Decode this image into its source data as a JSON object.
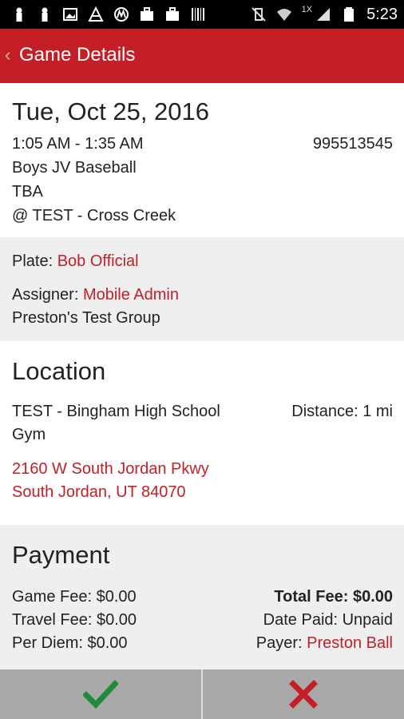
{
  "status_bar": {
    "time": "5:23",
    "network_label": "1X",
    "icons": [
      "notification-icon",
      "notification-icon",
      "image-icon",
      "app-icon",
      "motorola-icon",
      "briefcase-icon",
      "briefcase-icon",
      "barcode-icon",
      "no-vibrate-icon",
      "wifi-icon",
      "signal-icon",
      "battery-icon"
    ]
  },
  "toolbar": {
    "title": "Game Details"
  },
  "game": {
    "date": "Tue, Oct 25, 2016",
    "time_range": "1:05 AM - 1:35 AM",
    "game_id": "995513545",
    "level": "Boys JV Baseball",
    "opponent": "TBA",
    "host": "@ TEST - Cross Creek"
  },
  "assignments": {
    "plate_label": "Plate:",
    "plate_value": "Bob Official",
    "assigner_label": "Assigner:",
    "assigner_value": "Mobile Admin",
    "group": "Preston's Test Group"
  },
  "location": {
    "heading": "Location",
    "venue_line1": "TEST - Bingham High School",
    "venue_line2": "Gym",
    "distance": "Distance: 1 mi",
    "address_line1": "2160 W South Jordan Pkwy",
    "address_line2": "South Jordan, UT 84070"
  },
  "payment": {
    "heading": "Payment",
    "game_fee": "Game Fee: $0.00",
    "travel_fee": "Travel Fee: $0.00",
    "per_diem": "Per Diem: $0.00",
    "total_fee": "Total Fee: $0.00",
    "date_paid": "Date Paid: Unpaid",
    "payer_label": "Payer:",
    "payer_value": "Preston Ball"
  },
  "actions": {
    "accept_icon": "check-icon",
    "decline_icon": "x-icon"
  },
  "colors": {
    "brand": "#c41f26",
    "accept": "#1e8c3a",
    "decline": "#c41f26"
  }
}
